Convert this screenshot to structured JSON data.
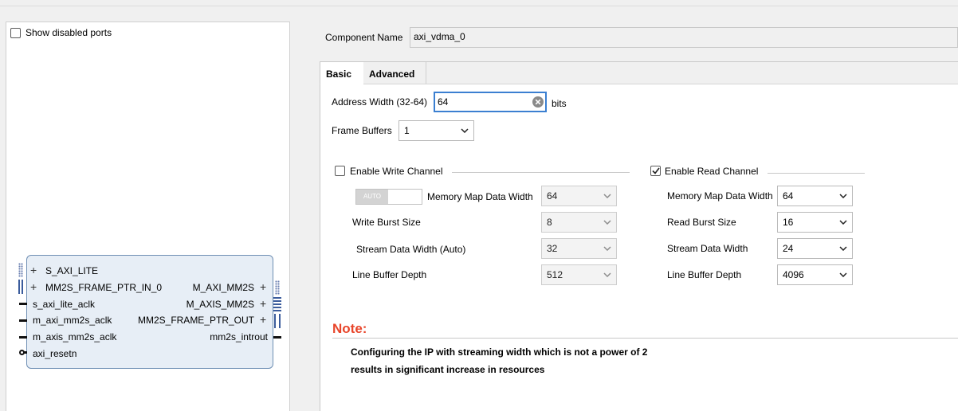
{
  "left_panel": {
    "show_disabled_ports_label": "Show disabled ports",
    "show_disabled_ports_checked": false,
    "block": {
      "left_ports": [
        "S_AXI_LITE",
        "MM2S_FRAME_PTR_IN_0",
        "s_axi_lite_aclk",
        "m_axi_mm2s_aclk",
        "m_axis_mm2s_aclk",
        "axi_resetn"
      ],
      "right_ports": [
        "M_AXI_MM2S",
        "M_AXIS_MM2S",
        "MM2S_FRAME_PTR_OUT",
        "mm2s_introut"
      ]
    }
  },
  "component": {
    "label": "Component Name",
    "value": "axi_vdma_0"
  },
  "tabs": [
    "Basic",
    "Advanced"
  ],
  "active_tab": "Basic",
  "basic": {
    "address_width_label": "Address Width (32-64)",
    "address_width_value": "64",
    "address_width_unit": "bits",
    "frame_buffers_label": "Frame Buffers",
    "frame_buffers_value": "1",
    "write_channel": {
      "label": "Enable Write Channel",
      "checked": false,
      "auto_toggle_label": "AUTO",
      "mm_data_width_label": "Memory Map Data Width",
      "mm_data_width_value": "64",
      "burst_label": "Write Burst Size",
      "burst_value": "8",
      "stream_label": "Stream Data Width (Auto)",
      "stream_value": "32",
      "line_buffer_label": "Line Buffer Depth",
      "line_buffer_value": "512"
    },
    "read_channel": {
      "label": "Enable Read Channel",
      "checked": true,
      "mm_data_width_label": "Memory Map Data Width",
      "mm_data_width_value": "64",
      "burst_label": "Read Burst Size",
      "burst_value": "16",
      "stream_label": "Stream Data Width",
      "stream_value": "24",
      "line_buffer_label": "Line Buffer Depth",
      "line_buffer_value": "4096"
    },
    "note": {
      "title": "Note:",
      "line1": "Configuring the IP with streaming width which is not a power of 2",
      "line2": "results in significant increase in resources"
    }
  },
  "colors": {
    "note_title": "#e8452a",
    "focus_border": "#3b7fd1",
    "block_fill": "#e7eef6",
    "block_border": "#6f8fb4"
  }
}
